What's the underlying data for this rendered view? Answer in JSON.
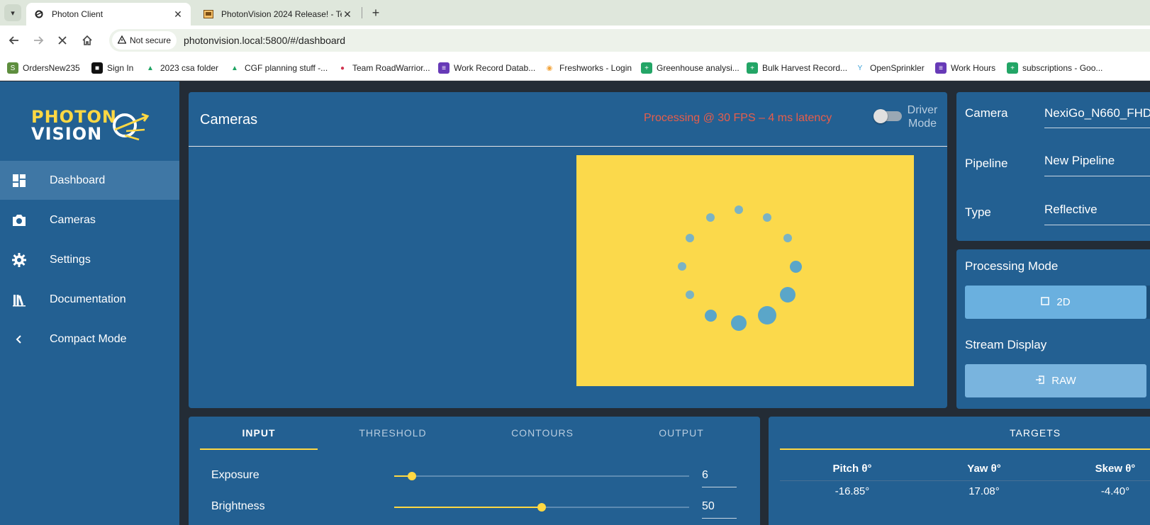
{
  "browser": {
    "tabs": [
      {
        "title": "Photon Client",
        "active": true
      },
      {
        "title": "PhotonVision 2024 Release! - Te",
        "active": false
      }
    ],
    "security_label": "Not secure",
    "url": "photonvision.local:5800/#/dashboard",
    "bookmarks": [
      {
        "label": "OrdersNew235",
        "icon": "shopify-icon",
        "color": "#5e8e3e"
      },
      {
        "label": "Sign In",
        "icon": "square-icon",
        "color": "#111111"
      },
      {
        "label": "2023 csa folder",
        "icon": "drive-icon",
        "color": "#1fa463"
      },
      {
        "label": "CGF planning stuff -...",
        "icon": "drive-icon",
        "color": "#1fa463"
      },
      {
        "label": "Team RoadWarrior...",
        "icon": "pin-icon",
        "color": "#d0344f"
      },
      {
        "label": "Work Record Datab...",
        "icon": "form-icon",
        "color": "#673ab7"
      },
      {
        "label": "Freshworks - Login",
        "icon": "freshworks-icon",
        "color": "#f2a33a"
      },
      {
        "label": "Greenhouse analysi...",
        "icon": "sheets-icon",
        "color": "#23a566"
      },
      {
        "label": "Bulk Harvest Record...",
        "icon": "sheets-icon",
        "color": "#23a566"
      },
      {
        "label": "OpenSprinkler",
        "icon": "sprinkler-icon",
        "color": "#3aa0d8"
      },
      {
        "label": "Work Hours",
        "icon": "form-icon",
        "color": "#673ab7"
      },
      {
        "label": "subscriptions - Goo...",
        "icon": "sheets-icon",
        "color": "#23a566"
      }
    ]
  },
  "logo": {
    "line1": "PHOTON",
    "line2": "VISION"
  },
  "sidebar": {
    "items": [
      {
        "label": "Dashboard",
        "icon": "dashboard-icon",
        "active": true
      },
      {
        "label": "Cameras",
        "icon": "camera-icon",
        "active": false
      },
      {
        "label": "Settings",
        "icon": "gear-icon",
        "active": false
      },
      {
        "label": "Documentation",
        "icon": "books-icon",
        "active": false
      },
      {
        "label": "Compact Mode",
        "icon": "chevron-left-icon",
        "active": false
      }
    ]
  },
  "cameras_panel": {
    "title": "Cameras",
    "status": "Processing @ 30 FPS – 4 ms latency",
    "driver_mode_label": "Driver Mode",
    "driver_mode_on": false
  },
  "config": {
    "camera_label": "Camera",
    "camera_value": "NexiGo_N660_FHD_",
    "pipeline_label": "Pipeline",
    "pipeline_value": "New Pipeline",
    "type_label": "Type",
    "type_value": "Reflective"
  },
  "modes": {
    "processing_title": "Processing Mode",
    "processing_button": "2D",
    "stream_title": "Stream Display",
    "stream_button": "RAW"
  },
  "pipeline_tabs": {
    "tabs": [
      "INPUT",
      "THRESHOLD",
      "CONTOURS",
      "OUTPUT"
    ],
    "active": 0,
    "sliders": [
      {
        "label": "Exposure",
        "value": "6",
        "fraction": 0.06
      },
      {
        "label": "Brightness",
        "value": "50",
        "fraction": 0.5
      }
    ]
  },
  "targets": {
    "title": "TARGETS",
    "headers": [
      "Pitch θ°",
      "Yaw θ°",
      "Skew θ°"
    ],
    "values": [
      "-16.85°",
      "17.08°",
      "-4.40°"
    ]
  },
  "colors": {
    "accent": "#ffd843",
    "panel": "#236092",
    "status_red": "#e85d4a",
    "stream_bg": "#fbd94b"
  }
}
